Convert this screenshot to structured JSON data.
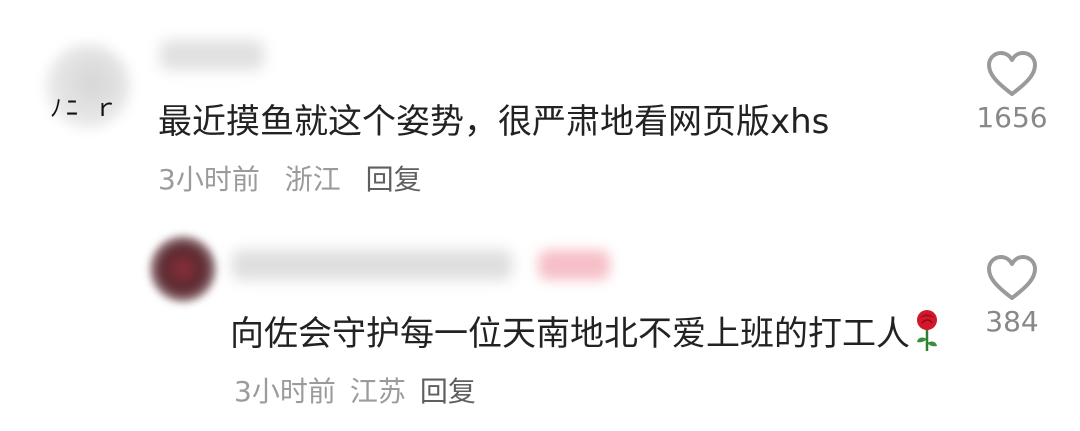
{
  "comments": [
    {
      "text": "最近摸鱼就这个姿势，很严肃地看网页版xhs",
      "time": "3小时前",
      "location": "浙江",
      "reply_label": "回复",
      "like_count": "1656"
    },
    {
      "text_main": "向佐会守护每一位天南地北不爱上班的打工人",
      "emoji": "rose-icon",
      "time": "3小时前",
      "location": "江苏",
      "reply_label": "回复",
      "like_count": "384"
    }
  ],
  "colors": {
    "text": "#222222",
    "meta": "#9b9b9b",
    "reply": "#5f5f5f",
    "like_count": "#888888",
    "heart_outline": "#9a9a9a",
    "rose": "#d3162a",
    "badge": "#f5b9c1"
  },
  "icons": {
    "like": "heart-outline-icon",
    "emoji": "rose-icon"
  }
}
